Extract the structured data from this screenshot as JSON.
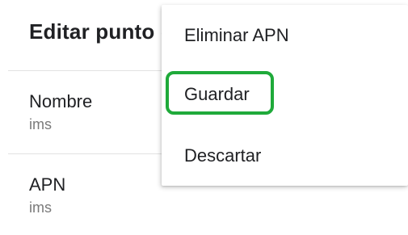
{
  "header": {
    "title": "Editar punto de acceso"
  },
  "fields": [
    {
      "label": "Nombre",
      "value": "ims"
    },
    {
      "label": "APN",
      "value": "ims"
    }
  ],
  "menu": {
    "items": [
      {
        "label": "Eliminar APN"
      },
      {
        "label": "Guardar"
      },
      {
        "label": "Descartar"
      }
    ],
    "highlighted_item": "Guardar",
    "highlight_color": "#1faa3a"
  }
}
